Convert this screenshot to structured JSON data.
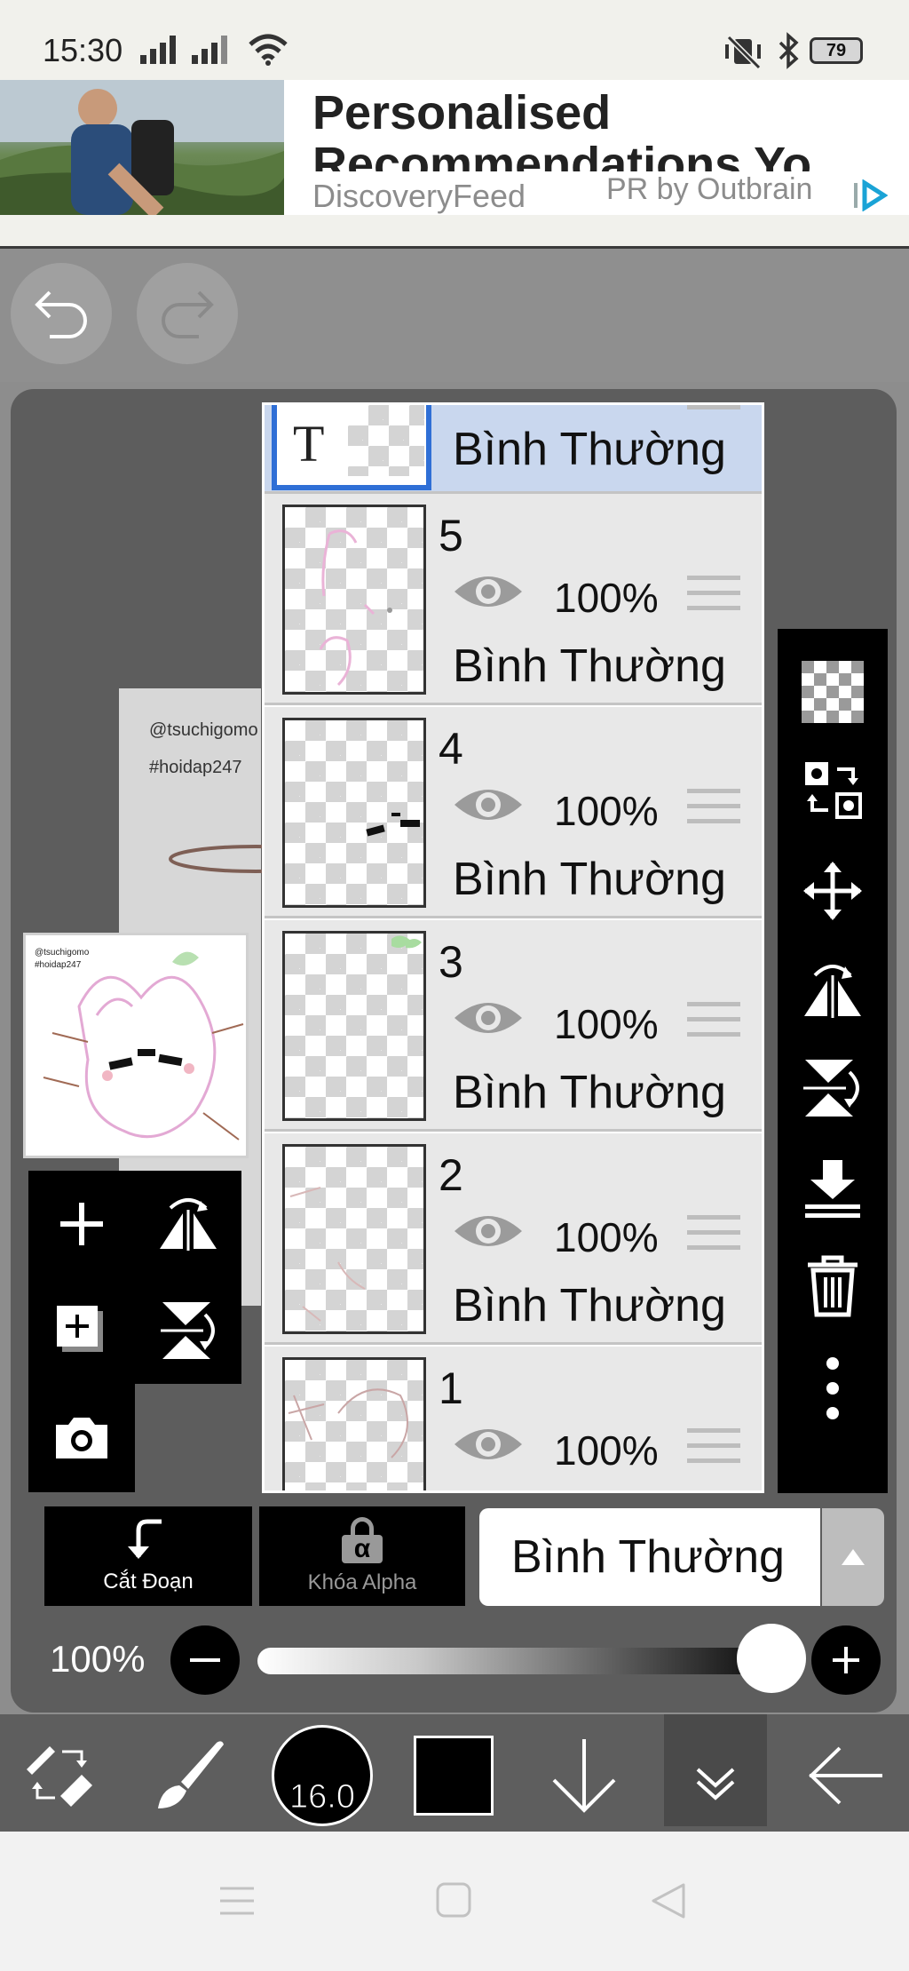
{
  "status": {
    "time": "15:30",
    "battery": "79"
  },
  "ad": {
    "headline": "Personalised Recommendations Yo",
    "source": "DiscoveryFeed",
    "sponsor": "PR by Outbrain"
  },
  "canvas": {
    "watermark_user": "@tsuchigomo",
    "watermark_tag": "#hoidap247"
  },
  "layers": [
    {
      "label": "",
      "blend": "Bình Thường",
      "type": "text"
    },
    {
      "label": "5",
      "opacity": "100%",
      "blend": "Bình Thường"
    },
    {
      "label": "4",
      "opacity": "100%",
      "blend": "Bình Thường"
    },
    {
      "label": "3",
      "opacity": "100%",
      "blend": "Bình Thường"
    },
    {
      "label": "2",
      "opacity": "100%",
      "blend": "Bình Thường"
    },
    {
      "label": "1",
      "opacity": "100%"
    }
  ],
  "text_layer_glyph": "T",
  "panel": {
    "clip_label": "Cắt Đoạn",
    "alpha_lock_label": "Khóa Alpha",
    "alpha_symbol": "α",
    "blend_mode": "Bình Thường",
    "opacity_label": "100%",
    "opacity_value": 1.0
  },
  "brush_size": "16.0",
  "icons": {
    "undo": "undo-icon",
    "redo": "redo-icon",
    "add": "plus-icon",
    "camera": "camera-icon",
    "trash": "trash-icon",
    "more": "more-vertical-icon"
  },
  "colors": {
    "selected_layer": "#c9d7ee",
    "selected_border": "#2f6fd6",
    "current_color": "#000000"
  }
}
